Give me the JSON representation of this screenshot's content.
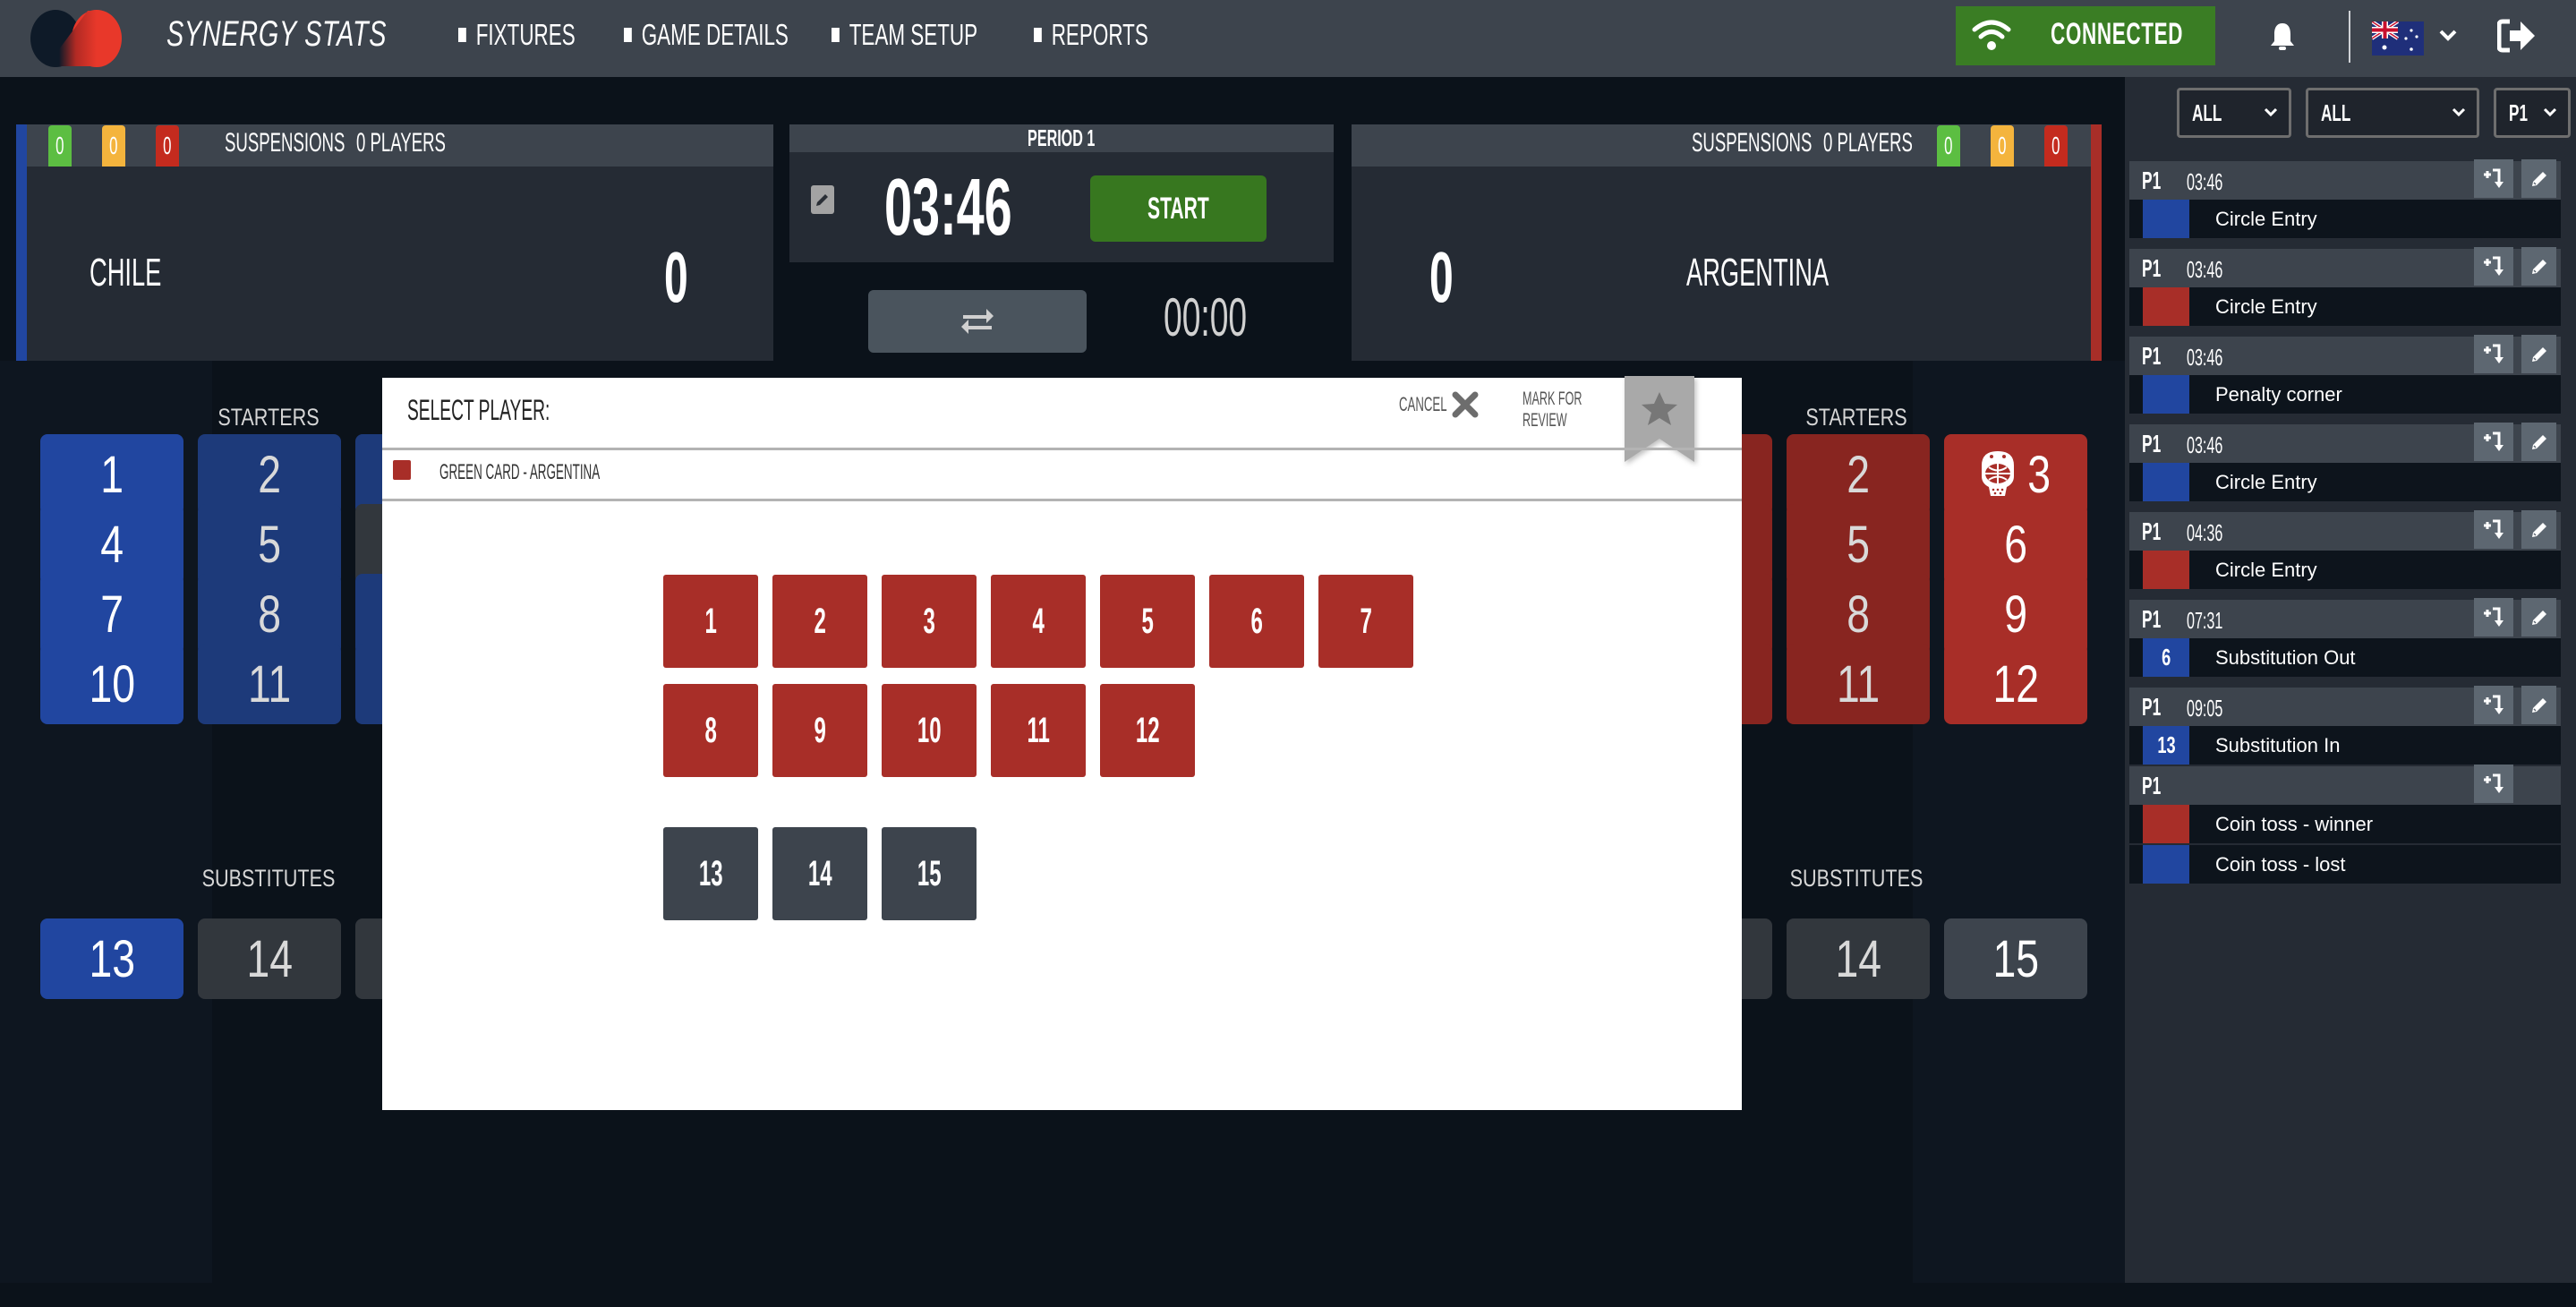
{
  "header": {
    "brand": "SYNERGY STATS",
    "nav": [
      {
        "label": "FIXTURES"
      },
      {
        "label": "GAME DETAILS"
      },
      {
        "label": "TEAM SETUP"
      },
      {
        "label": "REPORTS"
      }
    ],
    "connection_status": "CONNECTED",
    "icons": {
      "wifi": "wifi-icon",
      "bell": "bell-icon",
      "flag": "australia-flag-icon",
      "language_dropdown": "chevron-down-icon",
      "logout": "logout-icon"
    }
  },
  "colors": {
    "home": "#2146a0",
    "away": "#a82e28",
    "green_card": "#5cbe42",
    "yellow_card": "#f4b43d",
    "red_card": "#c42b1e",
    "connected": "#3a7d24",
    "start": "#37771f"
  },
  "scoreboard": {
    "home": {
      "name": "CHILE",
      "score": "0",
      "cards": {
        "green": "0",
        "yellow": "0",
        "red": "0"
      },
      "suspensions_label": "SUSPENSIONS",
      "suspensions_value": "0 PLAYERS"
    },
    "away": {
      "name": "ARGENTINA",
      "score": "0",
      "cards": {
        "green": "0",
        "yellow": "0",
        "red": "0"
      },
      "suspensions_label": "SUSPENSIONS",
      "suspensions_value": "0 PLAYERS"
    },
    "period": "PERIOD 1",
    "clock": "03:46",
    "start_label": "START",
    "sub_clock": "00:00"
  },
  "home_lineup": {
    "starters_label": "STARTERS",
    "substitutes_label": "SUBSTITUTES",
    "starters": [
      "1",
      "2",
      "4",
      "5",
      "7",
      "8",
      "10",
      "11"
    ],
    "substitutes": [
      "13",
      "14"
    ]
  },
  "away_lineup": {
    "starters_label": "STARTERS",
    "substitutes_label": "SUBSTITUTES",
    "starters": [
      "2",
      "3",
      "5",
      "6",
      "8",
      "9",
      "11",
      "12"
    ],
    "goalkeeper": "3",
    "substitutes": [
      "14",
      "15"
    ]
  },
  "feed": {
    "filters": [
      {
        "value": "ALL"
      },
      {
        "value": "ALL"
      },
      {
        "value": "P1"
      }
    ],
    "events": [
      {
        "period": "P1",
        "time": "03:46",
        "team": "home",
        "player": "",
        "label": "Circle Entry",
        "editable": true
      },
      {
        "period": "P1",
        "time": "03:46",
        "team": "away",
        "player": "",
        "label": "Circle Entry",
        "editable": true
      },
      {
        "period": "P1",
        "time": "03:46",
        "team": "home",
        "player": "",
        "label": "Penalty corner",
        "editable": true
      },
      {
        "period": "P1",
        "time": "03:46",
        "team": "home",
        "player": "",
        "label": "Circle Entry",
        "editable": true
      },
      {
        "period": "P1",
        "time": "04:36",
        "team": "away",
        "player": "",
        "label": "Circle Entry",
        "editable": true
      },
      {
        "period": "P1",
        "time": "07:31",
        "team": "home",
        "player": "6",
        "label": "Substitution Out",
        "editable": true
      },
      {
        "period": "P1",
        "time": "09:05",
        "team": "home",
        "player": "13",
        "label": "Substitution In",
        "editable": true
      }
    ],
    "coin_toss": {
      "period": "P1",
      "winner_label": "Coin toss - winner",
      "lost_label": "Coin toss - lost"
    }
  },
  "modal": {
    "title": "SELECT PLAYER:",
    "cancel_label": "CANCEL",
    "mark_for_review_label": "MARK FOR REVIEW",
    "event_description": "GREEN CARD - ARGENTINA",
    "starters": [
      "1",
      "2",
      "3",
      "4",
      "5",
      "6",
      "7",
      "8",
      "9",
      "10",
      "11",
      "12"
    ],
    "substitutes": [
      "13",
      "14",
      "15"
    ]
  }
}
